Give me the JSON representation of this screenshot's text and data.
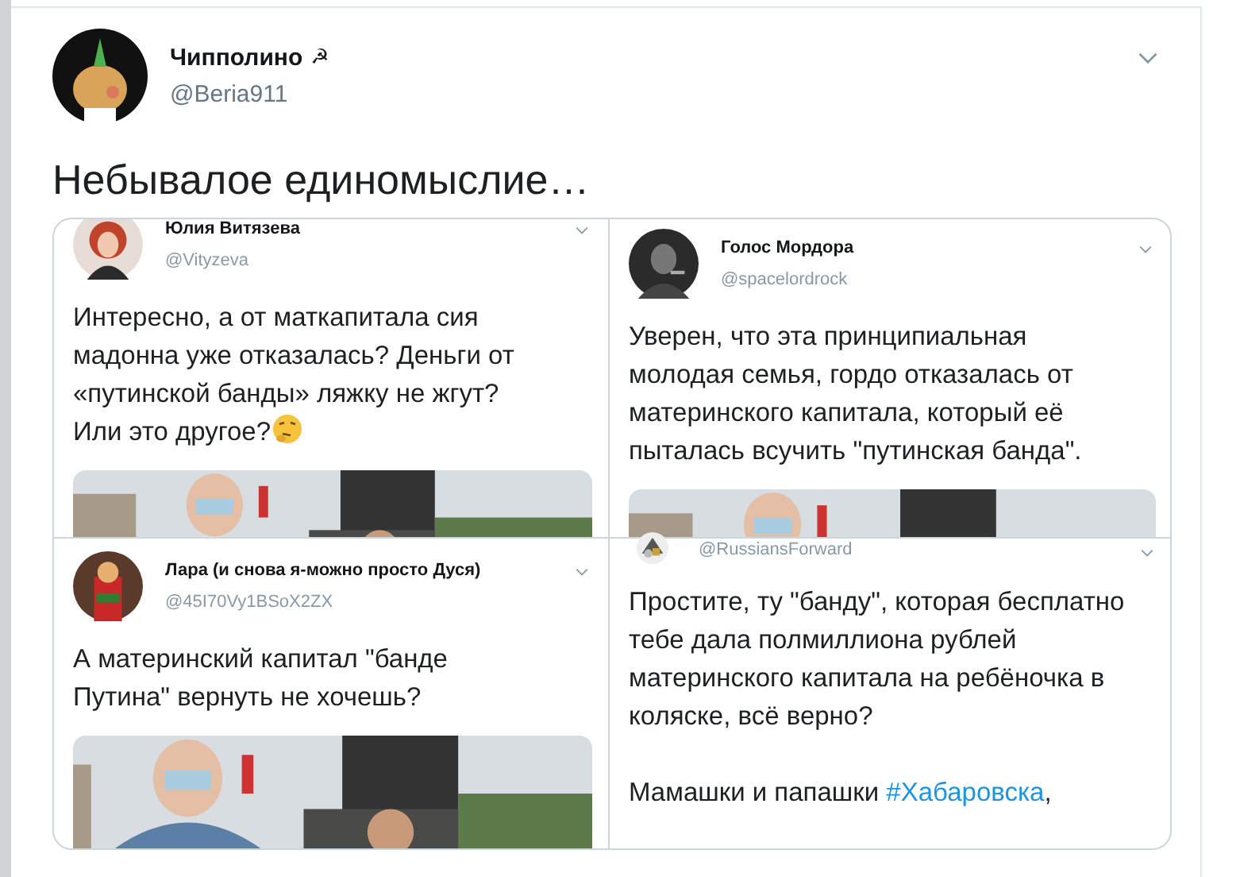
{
  "tweet": {
    "author": {
      "name": "Чипполино",
      "badge": "☭",
      "handle": "@Beria911"
    },
    "text": "Небывалое единомыслие…",
    "media": {
      "kind": "collage",
      "panels": [
        {
          "name": "Юлия Витязева",
          "handle": "@Vityzeva",
          "paragraphs": [
            [
              {
                "kind": "text",
                "text": "Интересно, а от маткапитала сия мадонна уже отказалась? Деньги от «путинской банды» ляжку не жгут?\nИли это другое?"
              },
              {
                "kind": "emoji"
              }
            ]
          ],
          "photo": {
            "kind": "picture"
          }
        },
        {
          "name": "Голос Мордора",
          "handle": "@spacelordrock",
          "paragraphs": [
            [
              {
                "kind": "text",
                "text": "Уверен, что эта принципиальная молодая семья, гордо отказалась от материнского капитала, который её пыталась всучить \"путинская банда\"."
              }
            ]
          ],
          "photo": {
            "kind": "picture"
          }
        },
        {
          "name": "Лара (и снова я-можно просто Дуся)",
          "handle": "@45I70Vy1BSoX2ZX",
          "paragraphs": [
            [
              {
                "kind": "text",
                "text": "А материнский капитал \"банде Путина\" вернуть не хочешь?"
              }
            ]
          ],
          "photo": {
            "kind": "picture"
          }
        },
        {
          "handle": "@RussiansForward",
          "paragraphs": [
            [
              {
                "kind": "text",
                "text": "Простите, ту \"банду\", которая бесплатно тебе дала полмиллиона рублей материнского капитала на ребёночка в коляске, всё верно?"
              }
            ],
            [
              {
                "kind": "text",
                "text": "Мамашки и папашки "
              },
              {
                "kind": "hashtag",
                "text": "#Хабаровска"
              },
              {
                "kind": "text",
                "text": ","
              }
            ]
          ]
        }
      ]
    }
  }
}
